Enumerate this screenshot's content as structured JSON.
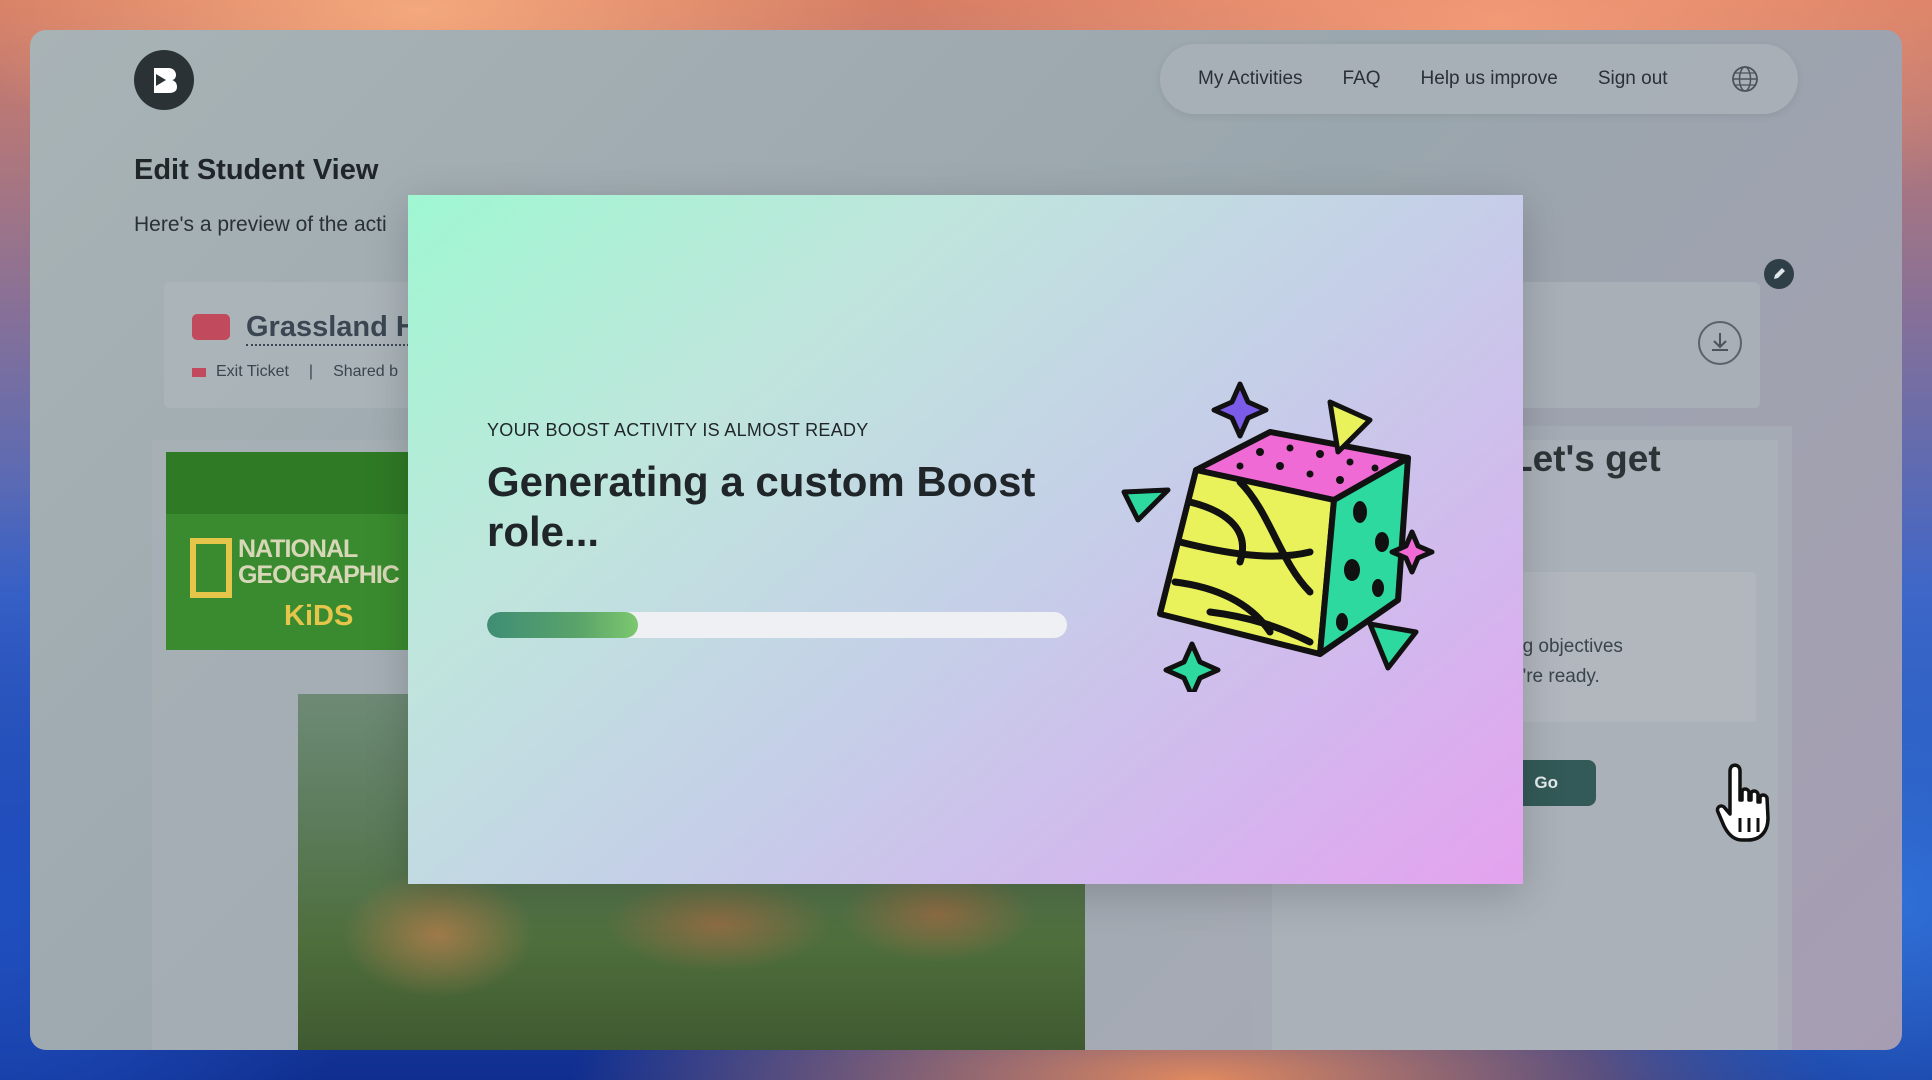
{
  "nav": {
    "items": [
      "My Activities",
      "FAQ",
      "Help us improve",
      "Sign out"
    ],
    "globe_icon": "globe-icon"
  },
  "page": {
    "title": "Edit Student View",
    "subtitle": "Here's a preview of the acti"
  },
  "activity": {
    "title": "Grassland H",
    "type": "Exit Ticket",
    "separator": "|",
    "shared": "Shared b"
  },
  "brand_card": {
    "line1": "NATIONAL",
    "line2": "GEOGRAPHIC",
    "line3": "KiDS"
  },
  "right_panel": {
    "heading": "Let's get",
    "objective_line1": "ng objectives",
    "objective_line2": "u're ready.",
    "button": "Go"
  },
  "modal": {
    "eyebrow": "YOUR BOOST ACTIVITY IS ALMOST READY",
    "title": "Generating a custom Boost role...",
    "progress": 0.26
  },
  "colors": {
    "accent": "#5aa36a",
    "ticket": "#c14a5c",
    "button": "#335a58"
  }
}
